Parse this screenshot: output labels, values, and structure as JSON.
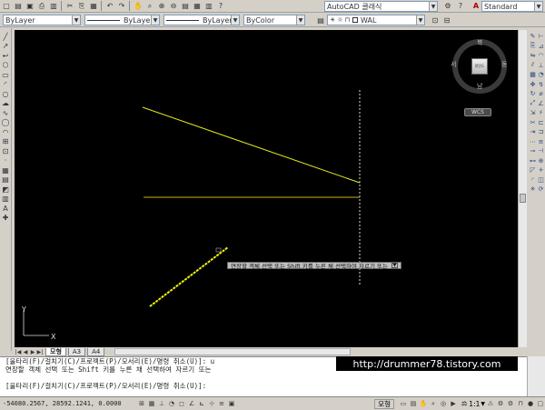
{
  "app": {
    "title": "AutoCAD 클래식"
  },
  "toolbar_top": {
    "workspace_combo": "AutoCAD 클래식",
    "style_combo": "Standard",
    "toolbar2_icon_names": [
      "layer-icon",
      "lightbulb-icon",
      "sun-icon",
      "lock-icon",
      "color-square-icon"
    ]
  },
  "properties": {
    "layer": "ByLayer",
    "linetype": "ByLayer",
    "lineweight": "ByLayer",
    "color": "ByColor",
    "current_layer": "WAL"
  },
  "left_toolbar": {
    "icons": [
      "line-icon",
      "construction-line-icon",
      "polyline-icon",
      "polygon-icon",
      "rectangle-icon",
      "arc-icon",
      "circle-icon",
      "revision-cloud-icon",
      "spline-icon",
      "ellipse-icon",
      "ellipse-arc-icon",
      "insert-block-icon",
      "make-block-icon",
      "point-icon",
      "hatch-icon",
      "gradient-icon",
      "region-icon",
      "table-icon",
      "text-icon",
      "add-selected-icon"
    ],
    "glyphs": [
      "╱",
      "↗",
      "↩",
      "⬡",
      "▭",
      "◜",
      "○",
      "☁",
      "∿",
      "◯",
      "◠",
      "⊞",
      "⊡",
      "·",
      "▦",
      "▤",
      "◩",
      "▥",
      "A",
      "✚"
    ]
  },
  "right_toolbar_1": {
    "icons": [
      "erase-icon",
      "copy-icon",
      "mirror-icon",
      "offset-icon",
      "array-icon",
      "move-icon",
      "rotate-icon",
      "scale-icon",
      "stretch-icon",
      "trim-icon",
      "extend-icon",
      "break-at-point-icon",
      "break-icon",
      "join-icon",
      "chamfer-icon",
      "fillet-icon",
      "explode-icon"
    ],
    "glyphs": [
      "✎",
      "⎘",
      "⇋",
      "⫽",
      "▦",
      "✥",
      "↻",
      "⤢",
      "⇲",
      "✂",
      "⇥",
      "⋯",
      "⊸",
      "⊷",
      "◸",
      "◜",
      "✳"
    ]
  },
  "right_toolbar_2": {
    "icons": [
      "dim-linear-icon",
      "dim-aligned-icon",
      "dim-arc-icon",
      "dim-ordinate-icon",
      "dim-radius-icon",
      "dim-jogged-icon",
      "dim-diameter-icon",
      "dim-angular-icon",
      "quick-dim-icon",
      "dim-baseline-icon",
      "dim-continue-icon",
      "dim-space-icon",
      "dim-break-icon",
      "tolerance-icon",
      "center-mark-icon",
      "inspection-icon",
      "dim-update-icon"
    ],
    "glyphs": [
      "⊢",
      "⊿",
      "◠",
      "⊥",
      "◔",
      "↯",
      "⌀",
      "∠",
      "⚡",
      "⊏",
      "⊐",
      "≡",
      "⊣",
      "⊕",
      "+",
      "◫",
      "⟳"
    ]
  },
  "nav": {
    "directions": {
      "north": "북",
      "south": "남",
      "west": "서",
      "east": "동"
    },
    "cube_label": "평면도",
    "wcs": "WCS"
  },
  "ucs": {
    "y_label": "Y",
    "x_label": "X"
  },
  "tooltip": {
    "text": "연장할 객체 선택 또는 Shift 키를 누른 채 선택하여 자르기 또는"
  },
  "tabs": [
    {
      "label": "모형",
      "active": true
    },
    {
      "label": "A3",
      "active": false
    },
    {
      "label": "A4",
      "active": false
    }
  ],
  "command": {
    "lines": [
      "[울타리(F)/걸치기(C)/프로젝트(P)/모서리(E)/명령 취소(U)]: u",
      "연장할 객체 선택 또는 Shift 키를 누른 채 선택하여 자르기 또는",
      "",
      "[울타리(F)/걸치기(C)/프로젝트(P)/모서리(E)/명령 취소(U)]:"
    ]
  },
  "watermark": "http://drummer78.tistory.com",
  "status": {
    "coords": "-54080.2567, 28592.1241, 0.0000",
    "model": "모형",
    "scale": "1:1"
  },
  "colors": {
    "canvas": "#000000",
    "yellow_line": "#e8e820",
    "horizontal_line": "#c8b020",
    "dotted_line": "#d8d8d8"
  }
}
